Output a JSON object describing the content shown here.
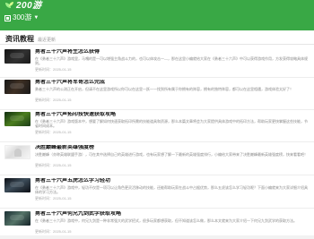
{
  "header": {
    "logo": "200游",
    "nav_label": "300游",
    "caret": "▼"
  },
  "section": {
    "title": "资讯教程",
    "subtitle": "最近更新"
  },
  "articles": [
    {
      "title": "勇者三十六声将生怎么获得",
      "desc": "在《勇者三十六声》游戏里，马嘎的是一可以增强主角战斗力的，也可以体攻击一—，那在这里小编就给大家在《勇者三十六声》中可以获得游戏作用，方发获得攻略具体规则。",
      "date": "更新时间：2025-01-15"
    },
    {
      "title": "勇者三十六声将军哥怎么完成",
      "desc": "勇者三十六声的公测正在开启，但请不在这里游戏所以你可以在这里一跃一一找到所有属于你拥有的阵容，拥有的独特阵容，都可以在这里相遇，游戏体验太好了！",
      "date": "更新时间：2025-01-15"
    },
    {
      "title": "勇者三十六声拓印技快速获取攻略",
      "desc": "在《勇者三十六声》游戏版本中，想要了解如何快速获取拓印所需的技能道具和资源，那么本篇文章将会为大家提供具体游戏中的拓印方法，帮助玩家更快掌握这些技能，节省时间成本。",
      "date": "更新时间：2025-01-15"
    },
    {
      "title": "决胜巅峰最新英雄强度榜",
      "desc": "决胜巅峰（亦称英雄联盟手游），可在其中选择自己的英雄进行游戏，也有玩家想了解一下最新的英雄强度排行，小编给大家带来了决胜巅峰最新英雄强度榜，快来看看吧！",
      "date": "更新时间：2025-01-15"
    },
    {
      "title": "勇者三十六声五虎怎么学习轻功",
      "desc": "在《勇者三十六声》游戏中，轻功不仅是一项可以让角色更灵活移动的技能，还能帮助玩家在战斗中占据优势，那么五虎该怎么学习轻功呢？下面小编就来为大家详细介绍具体的学习方法。",
      "date": "更新时间：2025-01-15"
    },
    {
      "title": "勇者三十六声何兄九剑武学获取攻略",
      "desc": "在《勇者三十六声》游戏中，何兄九剑是一种非常强大的武学招式，很多玩家都想获取，但不知道该怎么做，那么本文就来为大家介绍一下何兄九剑武学的获取方法。",
      "date": "更新时间：2025-01-15"
    }
  ]
}
